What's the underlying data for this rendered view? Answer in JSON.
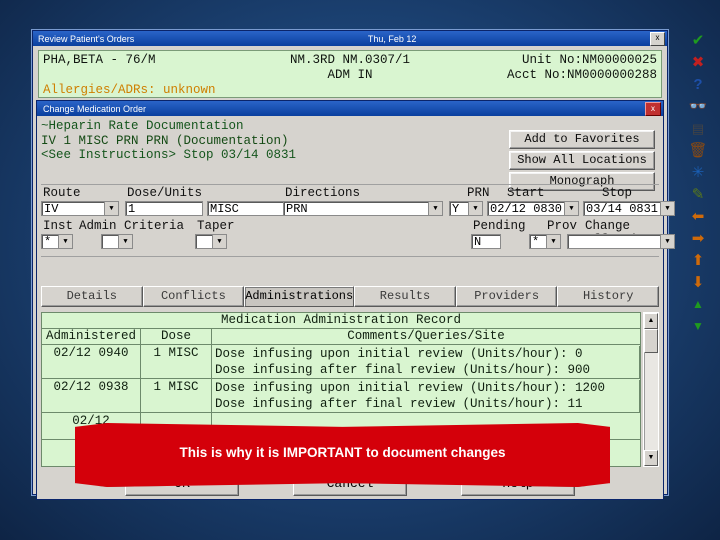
{
  "back_window": {
    "title": "Review Patient's Orders",
    "date": "Thu, Feb 12",
    "close_label": "x",
    "patient_line1_left": "PHA,BETA - 76/M",
    "patient_line1_mid": "NM.3RD NM.0307/1",
    "patient_line1_right": "Unit No:NM00000025",
    "patient_line2_mid": "ADM IN",
    "patient_line2_right": "Acct No:NM0000000288",
    "allergy": "Allergies/ADRs: unknown"
  },
  "front_window": {
    "title": "Change Medication Order",
    "close_label": "x",
    "order_text": {
      "line1": "~Heparin Rate Documentation",
      "line2": "IV 1 MISC PRN PRN (Documentation)",
      "line3": "<See Instructions>  Stop 03/14 0831"
    },
    "right_buttons": [
      "Add to Favorites",
      "Show All Locations",
      "Monograph"
    ],
    "fields": {
      "headers": {
        "route": "Route",
        "dose_units": "Dose/Units",
        "directions": "Directions",
        "prn": "PRN",
        "start": "Start",
        "stop": "Stop",
        "inst": "Inst",
        "admin_criteria": "Admin Criteria",
        "taper": "Taper",
        "pending": "Pending",
        "prov": "Prov",
        "change_effective": "Change Effective"
      },
      "values": {
        "route": "IV",
        "dose": "1",
        "units": "MISC",
        "directions": "PRN",
        "prn_flag": "Y",
        "start": "02/12 0830",
        "stop": "03/14 0831",
        "inst": "*",
        "admin_criteria": "",
        "taper": "",
        "pending": "N",
        "prov": "*",
        "change_effective": ""
      }
    },
    "tabs": [
      {
        "label": "Details",
        "selected": false
      },
      {
        "label": "Conflicts",
        "selected": false
      },
      {
        "label": "Administrations",
        "selected": true
      },
      {
        "label": "Results",
        "selected": false
      },
      {
        "label": "Providers",
        "selected": false
      },
      {
        "label": "History",
        "selected": false
      }
    ],
    "mar": {
      "title": "Medication Administration Record",
      "columns": [
        "Administered",
        "Dose",
        "Comments/Queries/Site"
      ],
      "rows": [
        {
          "administered": "02/12 0940",
          "dose": "1 MISC",
          "comments": [
            "Dose infusing upon initial review (Units/hour): 0",
            "Dose infusing after final review (Units/hour): 900"
          ]
        },
        {
          "administered": "02/12 0938",
          "dose": "1 MISC",
          "comments": [
            "Dose infusing upon initial review (Units/hour): 1200",
            "Dose infusing after final review (Units/hour): 11"
          ]
        },
        {
          "administered": "02/12",
          "dose": "",
          "comments": []
        }
      ]
    },
    "scrollbar": {
      "up": "▲",
      "down": "▼"
    },
    "bottom_buttons": [
      "OK",
      "Cancel",
      "Help"
    ]
  },
  "toolbar_icons": [
    {
      "name": "check-icon",
      "glyph": "✔",
      "color": "#1f9b1f"
    },
    {
      "name": "close-x-icon",
      "glyph": "✖",
      "color": "#c22020"
    },
    {
      "name": "help-question-icon",
      "glyph": "❓",
      "color": "#1d4fa8"
    },
    {
      "name": "binoculars-icon",
      "glyph": "👓",
      "color": "#333333"
    },
    {
      "name": "calculator-icon",
      "glyph": "🖩",
      "color": "#444444"
    },
    {
      "name": "trash-icon",
      "glyph": "🗑",
      "color": "#8a4a12"
    },
    {
      "name": "snowflake-icon",
      "glyph": "✳",
      "color": "#1a5fb4"
    },
    {
      "name": "pencil-icon",
      "glyph": "✎",
      "color": "#5a7a1a"
    },
    {
      "name": "arrow-left-icon",
      "glyph": "⬅",
      "color": "#cf6a0a"
    },
    {
      "name": "arrow-right-icon",
      "glyph": "➡",
      "color": "#cf6a0a"
    },
    {
      "name": "arrow-up-icon",
      "glyph": "⬆",
      "color": "#cf6a0a"
    },
    {
      "name": "arrow-down-icon",
      "glyph": "⬇",
      "color": "#cf6a0a"
    },
    {
      "name": "double-arrow-up-icon",
      "glyph": "⇞",
      "color": "#1f9b1f"
    },
    {
      "name": "double-arrow-down-icon",
      "glyph": "⇟",
      "color": "#1f9b1f"
    }
  ],
  "banner": {
    "text": "This is why it is IMPORTANT to document changes",
    "color": "#d4000a"
  }
}
